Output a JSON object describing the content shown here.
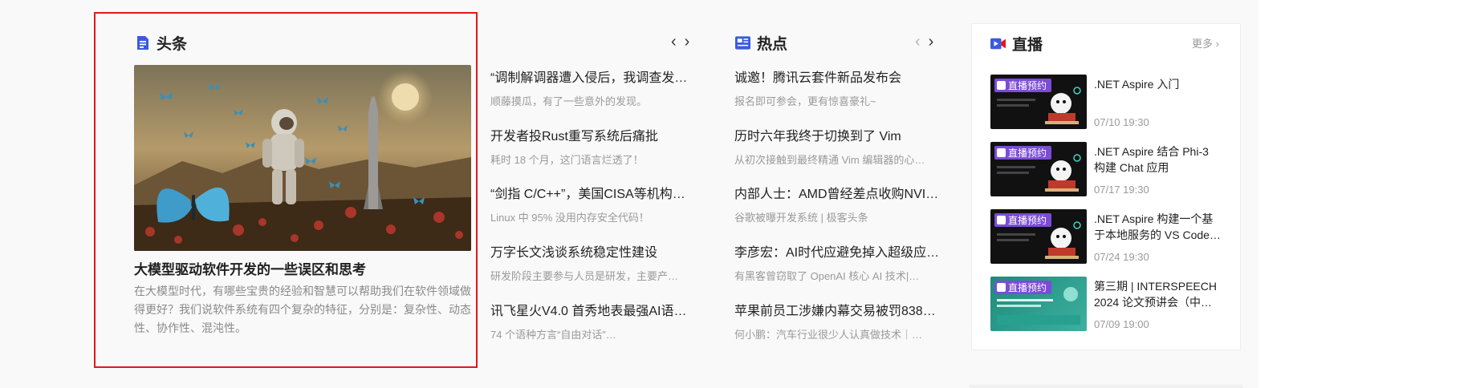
{
  "headline": {
    "section_title": "头条",
    "article_title": "大模型驱动软件开发的一些误区和思考",
    "article_desc": "在大模型时代，有哪些宝贵的经验和智慧可以帮助我们在软件领域做得更好？我们说软件系统有四个复杂的特征，分别是：复杂性、动态性、协作性、混沌性。"
  },
  "headline_list": [
    {
      "title": "“调制解调器遭入侵后，我调查发现…",
      "sub": "顺藤摸瓜，有了一些意外的发现。"
    },
    {
      "title": "开发者投Rust重写系统后痛批",
      "sub": "耗时 18 个月，这门语言烂透了！"
    },
    {
      "title": "“剑指 C/C++”，美国CISA等机构…",
      "sub": "Linux 中 95% 没用内存安全代码！"
    },
    {
      "title": "万字长文浅谈系统稳定性建设",
      "sub": "研发阶段主要参与人员是研发，主要产…"
    },
    {
      "title": "讯飞星火V4.0 首秀地表最强AI语…",
      "sub": "74 个语种方言“自由对话”…"
    }
  ],
  "hot": {
    "section_title": "热点",
    "items": [
      {
        "title": "诚邀！腾讯云套件新品发布会",
        "sub": "报名即可参会，更有惊喜豪礼~"
      },
      {
        "title": "历时六年我终于切换到了 Vim",
        "sub": "从初次接触到最终精通 Vim 编辑器的心…"
      },
      {
        "title": "内部人士：AMD曾经差点收购NVI…",
        "sub": "谷歌被曝开发系统 | 极客头条"
      },
      {
        "title": "李彦宏：AI时代应避免掉入超级应…",
        "sub": "有黑客曾窃取了 OpenAI 核心 AI 技术|…"
      },
      {
        "title": "苹果前员工涉嫌内幕交易被罚838…",
        "sub": "何小鹏：汽车行业很少人认真做技术｜…"
      }
    ]
  },
  "live": {
    "section_title": "直播",
    "more_label": "更多",
    "badge_label": "直播预约",
    "items": [
      {
        "title": ".NET Aspire 入门",
        "time": "07/10 19:30"
      },
      {
        "title": ".NET Aspire 结合 Phi-3 构建 Chat 应用",
        "time": "07/17 19:30"
      },
      {
        "title": ".NET Aspire 构建一个基于本地服务的 VS Code…",
        "time": "07/24 19:30"
      },
      {
        "title": "第三期 | INTERSPEECH 2024 论文预讲会（中…",
        "time": "07/09 19:00"
      }
    ]
  },
  "colors": {
    "accent": "#3b5bdb",
    "live_red": "#e0181e",
    "badge_purple": "#7b4cd6",
    "highlight_box": "#e0181e"
  },
  "icons": {
    "headline": "document-icon",
    "hot": "news-icon",
    "live": "video-camera-icon",
    "prev": "chevron-left-icon",
    "next": "chevron-right-icon"
  }
}
